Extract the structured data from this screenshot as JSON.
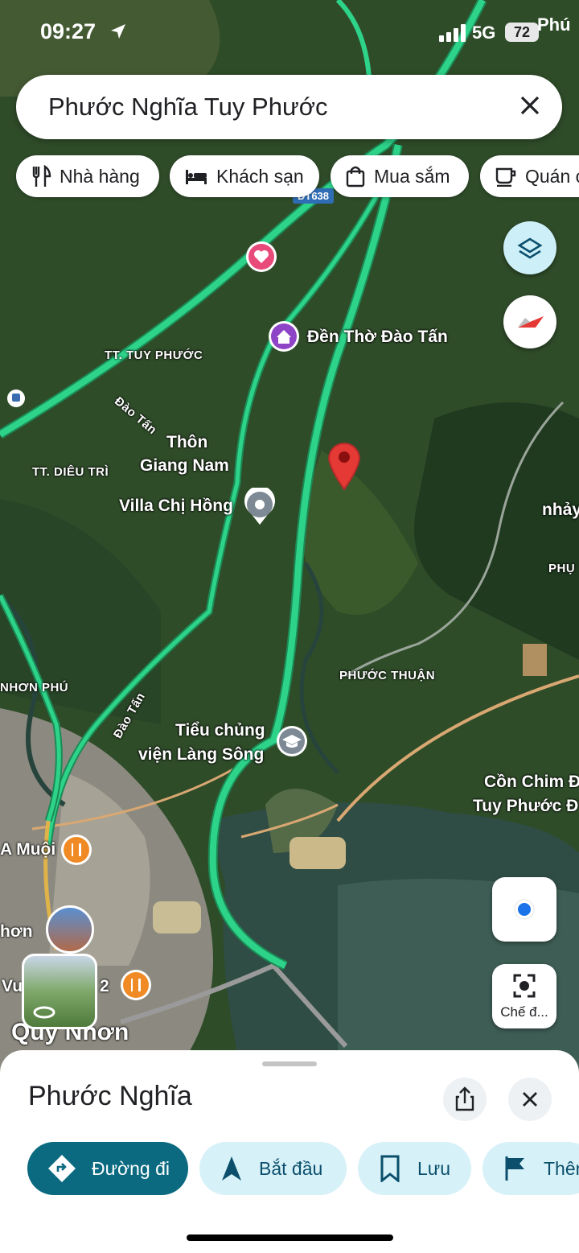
{
  "status": {
    "time": "09:27",
    "network": "5G",
    "battery": "72",
    "corner_label": "Phú"
  },
  "search": {
    "query": "Phước Nghĩa Tuy Phước"
  },
  "chips": [
    "Nhà hàng",
    "Khách sạn",
    "Mua sắm",
    "Quán c"
  ],
  "map": {
    "road_badge": "ĐT638",
    "labels": {
      "tuy_phuoc": "TT. TUY PHƯỚC",
      "dao_tan_1": "Đào Tấn",
      "thon": "Thôn",
      "giang_nam": "Giang Nam",
      "dieu_tri": "TT. DIÊU TRÌ",
      "villa": "Villa Chị Hồng",
      "den_tho": "Đền Thờ Đào Tấn",
      "nhay": "nhảy",
      "phu_right": "PHỤ",
      "phuoc_thuan": "PHƯỚC THUẬN",
      "nhon_phu": "NHƠN PHÚ",
      "dao_tan_2": "Đào Tấn",
      "tieu_chung_1": "Tiểu chủng",
      "tieu_chung_2": "viện Làng Sông",
      "con_chim_1": "Cồn Chim Đ",
      "con_chim_2": "Tuy Phước Đ",
      "a_muoi": "A Muội",
      "nhon_left": "hơn",
      "vu": "Vu",
      "two": "2",
      "quy_nhon": "Quy Nhơn"
    },
    "lens_label": "Chế đ..."
  },
  "sheet": {
    "title": "Phước Nghĩa",
    "actions": [
      "Đường đi",
      "Bắt đầu",
      "Lưu",
      "Thêm"
    ]
  },
  "colors": {
    "highway": "#2ed38a",
    "primary": "#0b6a80",
    "pin": "#e53935"
  }
}
